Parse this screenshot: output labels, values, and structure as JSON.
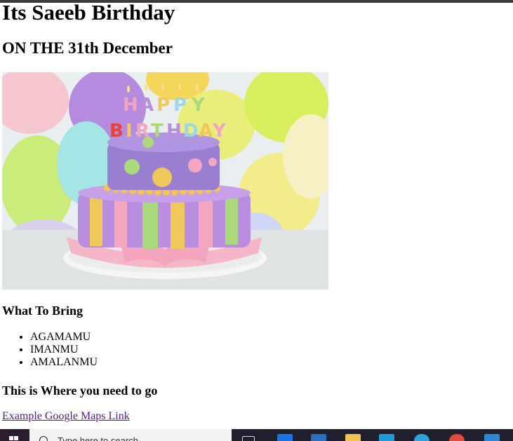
{
  "page": {
    "title": "Its Saeeb Birthday",
    "subtitle": "ON THE 31th December",
    "image_alt": "Birthday cake with Happy Birthday candles"
  },
  "what_to_bring": {
    "heading": "What To Bring",
    "items": [
      "AGAMAMU",
      "IMANMU",
      "AMALANMU"
    ]
  },
  "location": {
    "heading": "This is Where you need to go",
    "link_text": "Example Google Maps Link"
  },
  "taskbar": {
    "search_placeholder": "Type here to search",
    "apps": [
      "task-view-icon",
      "store-icon",
      "mail-icon",
      "file-explorer-icon",
      "edge-icon",
      "maps-icon",
      "chrome-icon",
      "vscode-icon"
    ]
  },
  "colors": {
    "link": "#551a8b",
    "taskbar": "#1f1f2e"
  }
}
